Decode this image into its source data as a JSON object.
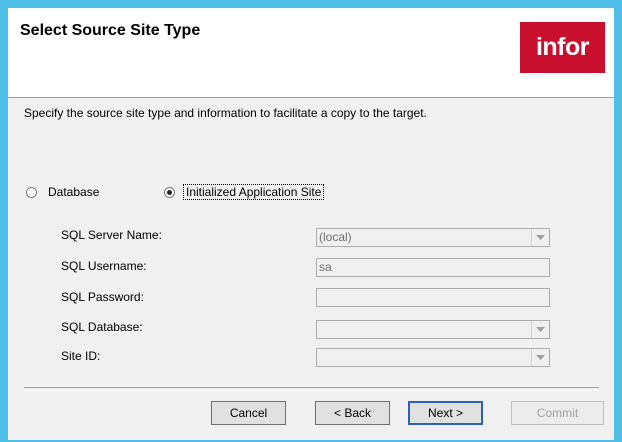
{
  "header": {
    "title": "Select Source Site Type",
    "logo_text": "infor",
    "logo_color": "#c8102e"
  },
  "description": "Specify the source site type and information to facilitate a copy to the target.",
  "source_type": {
    "options": [
      {
        "label": "Database",
        "checked": false
      },
      {
        "label": "Initialized Application Site",
        "checked": true
      }
    ]
  },
  "fields": {
    "server_name": {
      "label": "SQL Server Name:",
      "value": "(local)"
    },
    "username": {
      "label": "SQL Username:",
      "value": "sa"
    },
    "password": {
      "label": "SQL Password:",
      "value": ""
    },
    "database": {
      "label": "SQL Database:",
      "value": ""
    },
    "site_id": {
      "label": "Site ID:",
      "value": ""
    }
  },
  "buttons": {
    "cancel": "Cancel",
    "back": "< Back",
    "next": "Next >",
    "commit": "Commit"
  }
}
